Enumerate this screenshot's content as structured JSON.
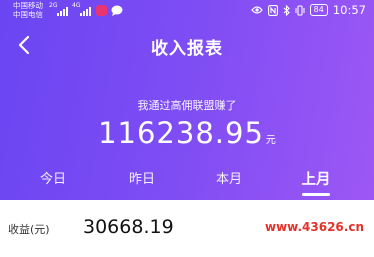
{
  "status_bar": {
    "carrier_1": "中国移动",
    "carrier_2": "中国电信",
    "network_1": "2G",
    "network_2": "4G",
    "battery": "84",
    "time": "10:57",
    "icons": [
      "signal-icon",
      "app-notification-icon",
      "chat-icon",
      "eye-icon",
      "nfc-icon",
      "bluetooth-icon",
      "vibrate-icon",
      "battery-icon"
    ]
  },
  "header": {
    "title": "收入报表",
    "subtitle": "我通过高佣联盟赚了",
    "amount": "116238.95",
    "amount_unit": "元",
    "colors": {
      "gradient_start": "#6a45f2",
      "gradient_end": "#9d57f5"
    }
  },
  "tabs": [
    {
      "label": "今日",
      "active": false
    },
    {
      "label": "昨日",
      "active": false
    },
    {
      "label": "本月",
      "active": false
    },
    {
      "label": "上月",
      "active": true
    }
  ],
  "earnings": {
    "label": "收益(元)",
    "value": "30668.19"
  },
  "watermark": "www.43626.cn"
}
